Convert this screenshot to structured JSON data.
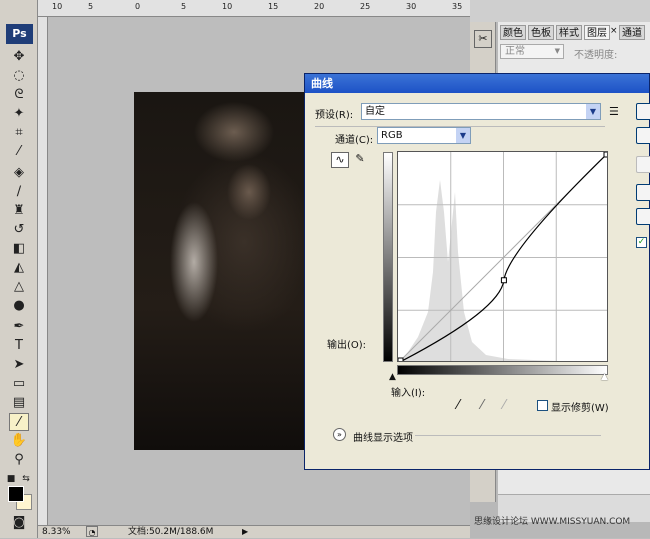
{
  "app": {
    "logo": "Ps"
  },
  "ruler": {
    "ticks": [
      "10",
      "5",
      "0",
      "5",
      "10",
      "15",
      "20",
      "25",
      "30",
      "35"
    ]
  },
  "status": {
    "zoom": "8.33%",
    "doc_info": "文档:50.2M/188.6M"
  },
  "right_panel": {
    "tabs": [
      "颜色",
      "色板",
      "样式",
      "图层",
      "通道"
    ],
    "blend_mode": "正常",
    "opacity_label": "不透明度:"
  },
  "curves_dialog": {
    "title": "曲线",
    "preset_label": "预设(R):",
    "preset_value": "自定",
    "channel_label": "通道(C):",
    "channel_value": "RGB",
    "output_label": "输出(O):",
    "input_label": "输入(I):",
    "show_clipping_label": "显示修剪(W)",
    "display_options_label": "曲线显示选项",
    "curve_points": [
      [
        0,
        0
      ],
      [
        128,
        100
      ],
      [
        255,
        255
      ]
    ]
  },
  "watermark": "思缘设计论坛  WWW.MISSYUAN.COM",
  "colors": {
    "accent": "#1d52c6",
    "foreground": "#000000",
    "background": "#fff5d0"
  }
}
